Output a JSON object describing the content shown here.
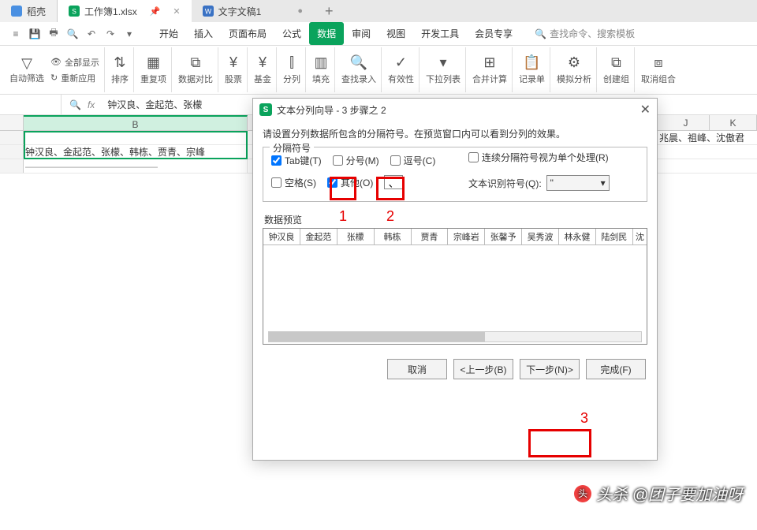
{
  "tabs": {
    "home": "稻壳",
    "t1": "工作簿1.xlsx",
    "t2": "文字文稿1"
  },
  "menus": [
    "开始",
    "插入",
    "页面布局",
    "公式",
    "数据",
    "审阅",
    "视图",
    "开发工具",
    "会员专享"
  ],
  "search_hint": "查找命令、搜索模板",
  "ribbon": {
    "autofilter": "自动筛选",
    "showall": "全部显示",
    "reapply": "重新应用",
    "sort": "排序",
    "duplicates": "重复项",
    "datacompare": "数据对比",
    "stock": "股票",
    "fund": "基金",
    "textcol": "分列",
    "fill": "填充",
    "lookup": "查找录入",
    "validation": "有效性",
    "droplist": "下拉列表",
    "consolidate": "合并计算",
    "record": "记录单",
    "simulate": "模拟分析",
    "group": "创建组",
    "ungroup": "取消组合"
  },
  "formula_bar": "钟汉良、金起范、张檬",
  "columns": {
    "b": "B",
    "j": "J",
    "k": "K"
  },
  "cell_b2": "钟汉良、金起范、张檬、韩栋、贾青、宗峰",
  "overflow_right": "兆晨、祖峰、沈傲君",
  "dialog": {
    "title": "文本分列向导 - 3 步骤之 2",
    "instruction": "请设置分列数据所包含的分隔符号。在预览窗口内可以看到分列的效果。",
    "fieldset_label": "分隔符号",
    "tab": "Tab键(T)",
    "semicolon": "分号(M)",
    "comma": "逗号(C)",
    "space": "空格(S)",
    "other": "其他(O)",
    "other_value": "、",
    "treat_consecutive": "连续分隔符号视为单个处理(R)",
    "text_qualifier_label": "文本识别符号(Q):",
    "text_qualifier_value": "\"",
    "preview_label": "数据预览",
    "preview_cols": [
      "钟汉良",
      "金起范",
      "张檬",
      "韩栋",
      "贾青",
      "宗峰岩",
      "张馨予",
      "吴秀波",
      "林永健",
      "陆剑民",
      "沈"
    ],
    "btn_cancel": "取消",
    "btn_back": "<上一步(B)",
    "btn_next": "下一步(N)>",
    "btn_finish": "完成(F)"
  },
  "annotations": {
    "a1": "1",
    "a2": "2",
    "a3": "3"
  },
  "watermark": "头杀 @团子要加油呀"
}
